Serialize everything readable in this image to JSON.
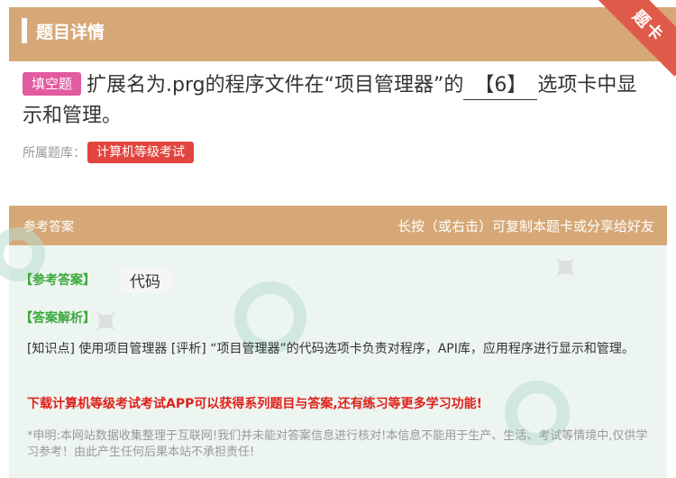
{
  "header": {
    "title": "题目详情",
    "corner_label": "题卡"
  },
  "question": {
    "type_tag": "填空题",
    "text_before": "扩展名为.prg的程序文件在“项目管理器”的",
    "blank": "【6】",
    "text_after": "选项卡中显示和管理。"
  },
  "bank": {
    "label": "所属题库：",
    "name": "计算机等级考试"
  },
  "answer_section": {
    "header_left": "参考答案",
    "header_right": "长按（或右击）可复制本题卡或分享给好友",
    "answer_label": "【参考答案】",
    "answer_value": "代码",
    "explain_label": "【答案解析】",
    "explain_text": "[知识点] 使用项目管理器 [评析] “项目管理器”的代码选项卡负责对程序，API库，应用程序进行显示和管理。",
    "promo": "下载计算机等级考试考试APP可以获得系列题目与答案,还有练习等更多学习功能!",
    "disclaimer": "*申明:本网站数据收集整理于互联网!我们并未能对答案信息进行核对!本信息不能用于生产、生活、考试等情境中,仅供学习参考！由此产生任何后果本站不承担责任!"
  },
  "colors": {
    "header": "#d6a877",
    "corner": "#e05a4a",
    "type_tag": "#e25a9f",
    "bank_tag": "#e0463f",
    "answer_bg": "#edf5f1",
    "label_green": "#3aa83a",
    "promo_red": "#e0201a"
  }
}
